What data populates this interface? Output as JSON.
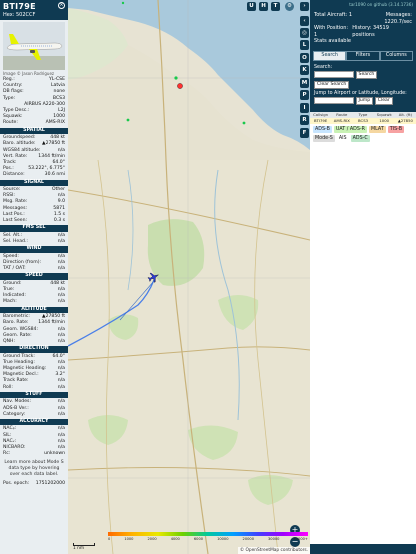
{
  "aircraft": {
    "callsign": "BTI79E",
    "hex_label": "Hex: 502CCF",
    "photo_credit": "Image © Jason Rodriguez"
  },
  "info_rows": [
    {
      "k": "Reg.:",
      "v": "YL-CSE"
    },
    {
      "k": "Country:",
      "v": "Latvia"
    },
    {
      "k": "DB flags:",
      "v": "none"
    },
    {
      "k": "Type:",
      "v": "BCS3"
    },
    {
      "k": "",
      "v": "AIRBUS A220-300"
    },
    {
      "k": "Type Desc.:",
      "v": "L2J"
    },
    {
      "k": "Squawk:",
      "v": "1000"
    },
    {
      "k": "Route:",
      "v": "AMS-RIX"
    }
  ],
  "sections": [
    {
      "title": "SPATIAL",
      "rows": [
        {
          "k": "Groundspeed:",
          "v": "448 kt"
        },
        {
          "k": "Baro. altitude:",
          "v": "▲27850 ft"
        },
        {
          "k": "WGS84 altitude:",
          "v": "n/a"
        },
        {
          "k": "Vert. Rate:",
          "v": "1344 ft/min"
        },
        {
          "k": "Track:",
          "v": "64.0°"
        },
        {
          "k": "Pos.:",
          "v": "53.222°, 6.775°"
        },
        {
          "k": "Distance:",
          "v": "30.6 nmi"
        }
      ]
    },
    {
      "title": "SIGNAL",
      "rows": [
        {
          "k": "Source:",
          "v": "Other"
        },
        {
          "k": "RSSI:",
          "v": "n/a"
        },
        {
          "k": "Msg. Rate:",
          "v": "9.0"
        },
        {
          "k": "Messages:",
          "v": "5871"
        },
        {
          "k": "Last Pos.:",
          "v": "1.5 s"
        },
        {
          "k": "Last Seen:",
          "v": "0.3 s"
        }
      ]
    },
    {
      "title": "FMS SEL",
      "rows": [
        {
          "k": "Sel. Alt.:",
          "v": "n/a"
        },
        {
          "k": "Sel. Head.:",
          "v": "n/a"
        }
      ]
    },
    {
      "title": "WIND",
      "rows": [
        {
          "k": "Speed:",
          "v": "n/a"
        },
        {
          "k": "Direction (from):",
          "v": "n/a"
        },
        {
          "k": "TAT / OAT:",
          "v": "n/a"
        }
      ]
    },
    {
      "title": "SPEED",
      "rows": [
        {
          "k": "Ground:",
          "v": "448 kt"
        },
        {
          "k": "True:",
          "v": "n/a"
        },
        {
          "k": "Indicated:",
          "v": "n/a"
        },
        {
          "k": "Mach:",
          "v": "n/a"
        }
      ]
    },
    {
      "title": "ALTITUDE",
      "rows": [
        {
          "k": "Barometric:",
          "v": "▲27850 ft"
        },
        {
          "k": "Baro. Rate:",
          "v": "1344 ft/min"
        },
        {
          "k": "Geom. WGS84:",
          "v": "n/a"
        },
        {
          "k": "Geom. Rate:",
          "v": "n/a"
        },
        {
          "k": "QNH:",
          "v": "n/a"
        }
      ]
    },
    {
      "title": "DIRECTION",
      "rows": [
        {
          "k": "Ground Track:",
          "v": "64.0°"
        },
        {
          "k": "True Heading:",
          "v": "n/a"
        },
        {
          "k": "Magnetic Heading:",
          "v": "n/a"
        },
        {
          "k": "Magnetic Decl.:",
          "v": "3.2°"
        },
        {
          "k": "Track Rate:",
          "v": "n/a"
        },
        {
          "k": "Roll:",
          "v": "n/a"
        }
      ]
    },
    {
      "title": "STUFF",
      "rows": [
        {
          "k": "Nav. Modes:",
          "v": "n/a"
        },
        {
          "k": "ADS-B Ver.:",
          "v": "n/a"
        },
        {
          "k": "Category:",
          "v": "n/a"
        }
      ]
    },
    {
      "title": "ACCURACY",
      "rows": [
        {
          "k": "NACₚ:",
          "v": "n/a"
        },
        {
          "k": "SIL:",
          "v": "n/a"
        },
        {
          "k": "NACᵥ:",
          "v": "n/a"
        },
        {
          "k": "NICBARO:",
          "v": "n/a"
        },
        {
          "k": "Rc:",
          "v": "unknown"
        }
      ]
    }
  ],
  "learn_more": "Learn more about Mode S data type by hovering over each data label.",
  "pos_epoch": {
    "k": "Pos. epoch:",
    "v": "1751202000"
  },
  "map": {
    "top_buttons": [
      "U",
      "H",
      "T"
    ],
    "layer_buttons": [
      "L",
      "O",
      "K",
      "M",
      "P",
      "I",
      "R",
      "F"
    ],
    "attribution": "© OpenStreetMap contributors.",
    "scale": "1 nm",
    "alt_ticks": [
      "0",
      "1000",
      "2000",
      "4000",
      "6000",
      "10000",
      "20000",
      "30000",
      "40000+"
    ]
  },
  "right": {
    "top_link": "tar1090 on github (3.14.1736)",
    "total_aircraft_label": "Total Aircraft:",
    "total_aircraft": "1",
    "messages_label": "Messages:",
    "messages": "1220.7/sec",
    "with_position_label": "With Position:",
    "with_position": "1",
    "history_label": "History:",
    "history": "34519 positions",
    "stats_label": "Stats available",
    "tabs": [
      "Search",
      "Filters",
      "Columns"
    ],
    "search_label": "Search:",
    "search_button": "Search",
    "clear_search": "Clear Search",
    "jump_label": "Jump to Airport or Latitude, Longitude:",
    "jump_button": "Jump",
    "clear_button": "Clear",
    "columns": [
      "Callsign",
      "Route",
      "Type",
      "Squawk",
      "Alt. (ft)"
    ],
    "row": [
      "BTI79E",
      "AMS-RIX",
      "BCS3",
      "1000",
      "▲27850"
    ],
    "sources": [
      {
        "label": "ADS-B",
        "color": "#c7e5ff"
      },
      {
        "label": "UAT / ADS-R",
        "color": "#c9f2b5"
      },
      {
        "label": "MLAT",
        "color": "#f5d7a1"
      },
      {
        "label": "TIS-B",
        "color": "#f7a2a2"
      },
      {
        "label": "Mode-S",
        "color": "#dcdcdc"
      },
      {
        "label": "AIS",
        "color": "#ffffff"
      },
      {
        "label": "ADS-C",
        "color": "#bde7c9"
      }
    ]
  }
}
